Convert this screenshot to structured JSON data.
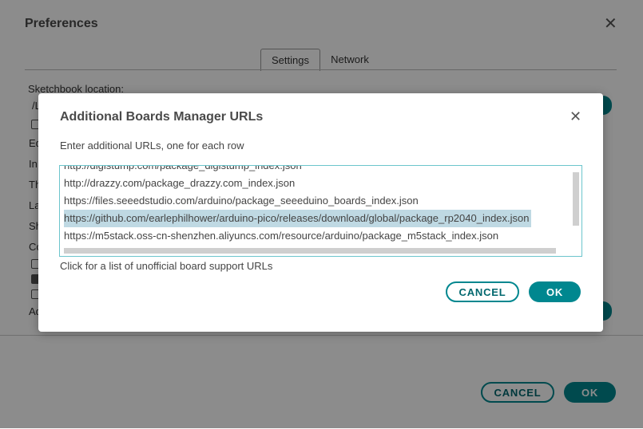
{
  "preferences": {
    "title": "Preferences",
    "close": "✕",
    "tabs": [
      {
        "label": "Settings"
      },
      {
        "label": "Network"
      }
    ],
    "sketchbook_label": "Sketchbook location:",
    "fragments": [
      "/L",
      "Ed",
      "In",
      "Th",
      "La",
      "Sh",
      "Co",
      "Ad"
    ],
    "cancel_label": "CANCEL",
    "ok_label": "OK"
  },
  "dialog": {
    "title": "Additional Boards Manager URLs",
    "close": "✕",
    "instructions": "Enter additional URLs, one for each row",
    "urls": [
      "http://digistump.com/package_digistump_index.json",
      "http://drazzy.com/package_drazzy.com_index.json",
      "https://files.seeedstudio.com/arduino/package_seeeduino_boards_index.json",
      "https://github.com/earlephilhower/arduino-pico/releases/download/global/package_rp2040_index.json",
      "https://m5stack.oss-cn-shenzhen.aliyuncs.com/resource/arduino/package_m5stack_index.json"
    ],
    "selected_index": 3,
    "link_text": "Click for a list of unofficial board support URLs",
    "cancel_label": "CANCEL",
    "ok_label": "OK"
  },
  "colors": {
    "accent": "#00878f",
    "selection": "#bfd9e3",
    "focus_border": "#6cc5cc"
  }
}
